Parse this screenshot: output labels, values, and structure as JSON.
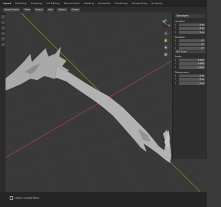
{
  "topbar": {
    "tabs": [
      "Layout",
      "Modeling",
      "Sculpting",
      "UV Editing",
      "Texture Paint",
      "Shading",
      "Animation",
      "Rendering",
      "Compositing",
      "Scripting"
    ],
    "active_index": 0
  },
  "header": {
    "mode": "Object Mode",
    "menus": [
      "View",
      "Select",
      "Add",
      "Object"
    ],
    "orientation": "Global"
  },
  "viewport": {
    "object": "scythe-blade-model",
    "axis_colors": {
      "x": "#b4434f",
      "y": "#7fa62e",
      "z": "#3d6fc7"
    }
  },
  "navigation": {
    "gizmo_axes": [
      "X",
      "Y",
      "Z"
    ]
  },
  "n_panel": {
    "tab": "Transform",
    "location_label": "Location:",
    "location": [
      {
        "axis": "X",
        "value": "0 m"
      },
      {
        "axis": "Y",
        "value": "0 m"
      },
      {
        "axis": "Z",
        "value": "0 m"
      }
    ],
    "rotation_label": "Rotation:",
    "rotation": [
      {
        "axis": "X",
        "value": "0°"
      },
      {
        "axis": "Y",
        "value": "0°"
      },
      {
        "axis": "Z",
        "value": "0°"
      }
    ],
    "rotation_mode": "XYZ Euler",
    "scale_label": "Scale:",
    "scale": [
      {
        "axis": "X",
        "value": "1.000"
      },
      {
        "axis": "Y",
        "value": "1.000"
      },
      {
        "axis": "Z",
        "value": "1.000"
      }
    ],
    "dimensions_label": "Dimensions:",
    "dimensions": [
      {
        "axis": "X",
        "value": "0 m"
      },
      {
        "axis": "Y",
        "value": "0 m"
      },
      {
        "axis": "Z",
        "value": "0 m"
      }
    ]
  },
  "status": {
    "context_menu": "Object Context Menu"
  }
}
